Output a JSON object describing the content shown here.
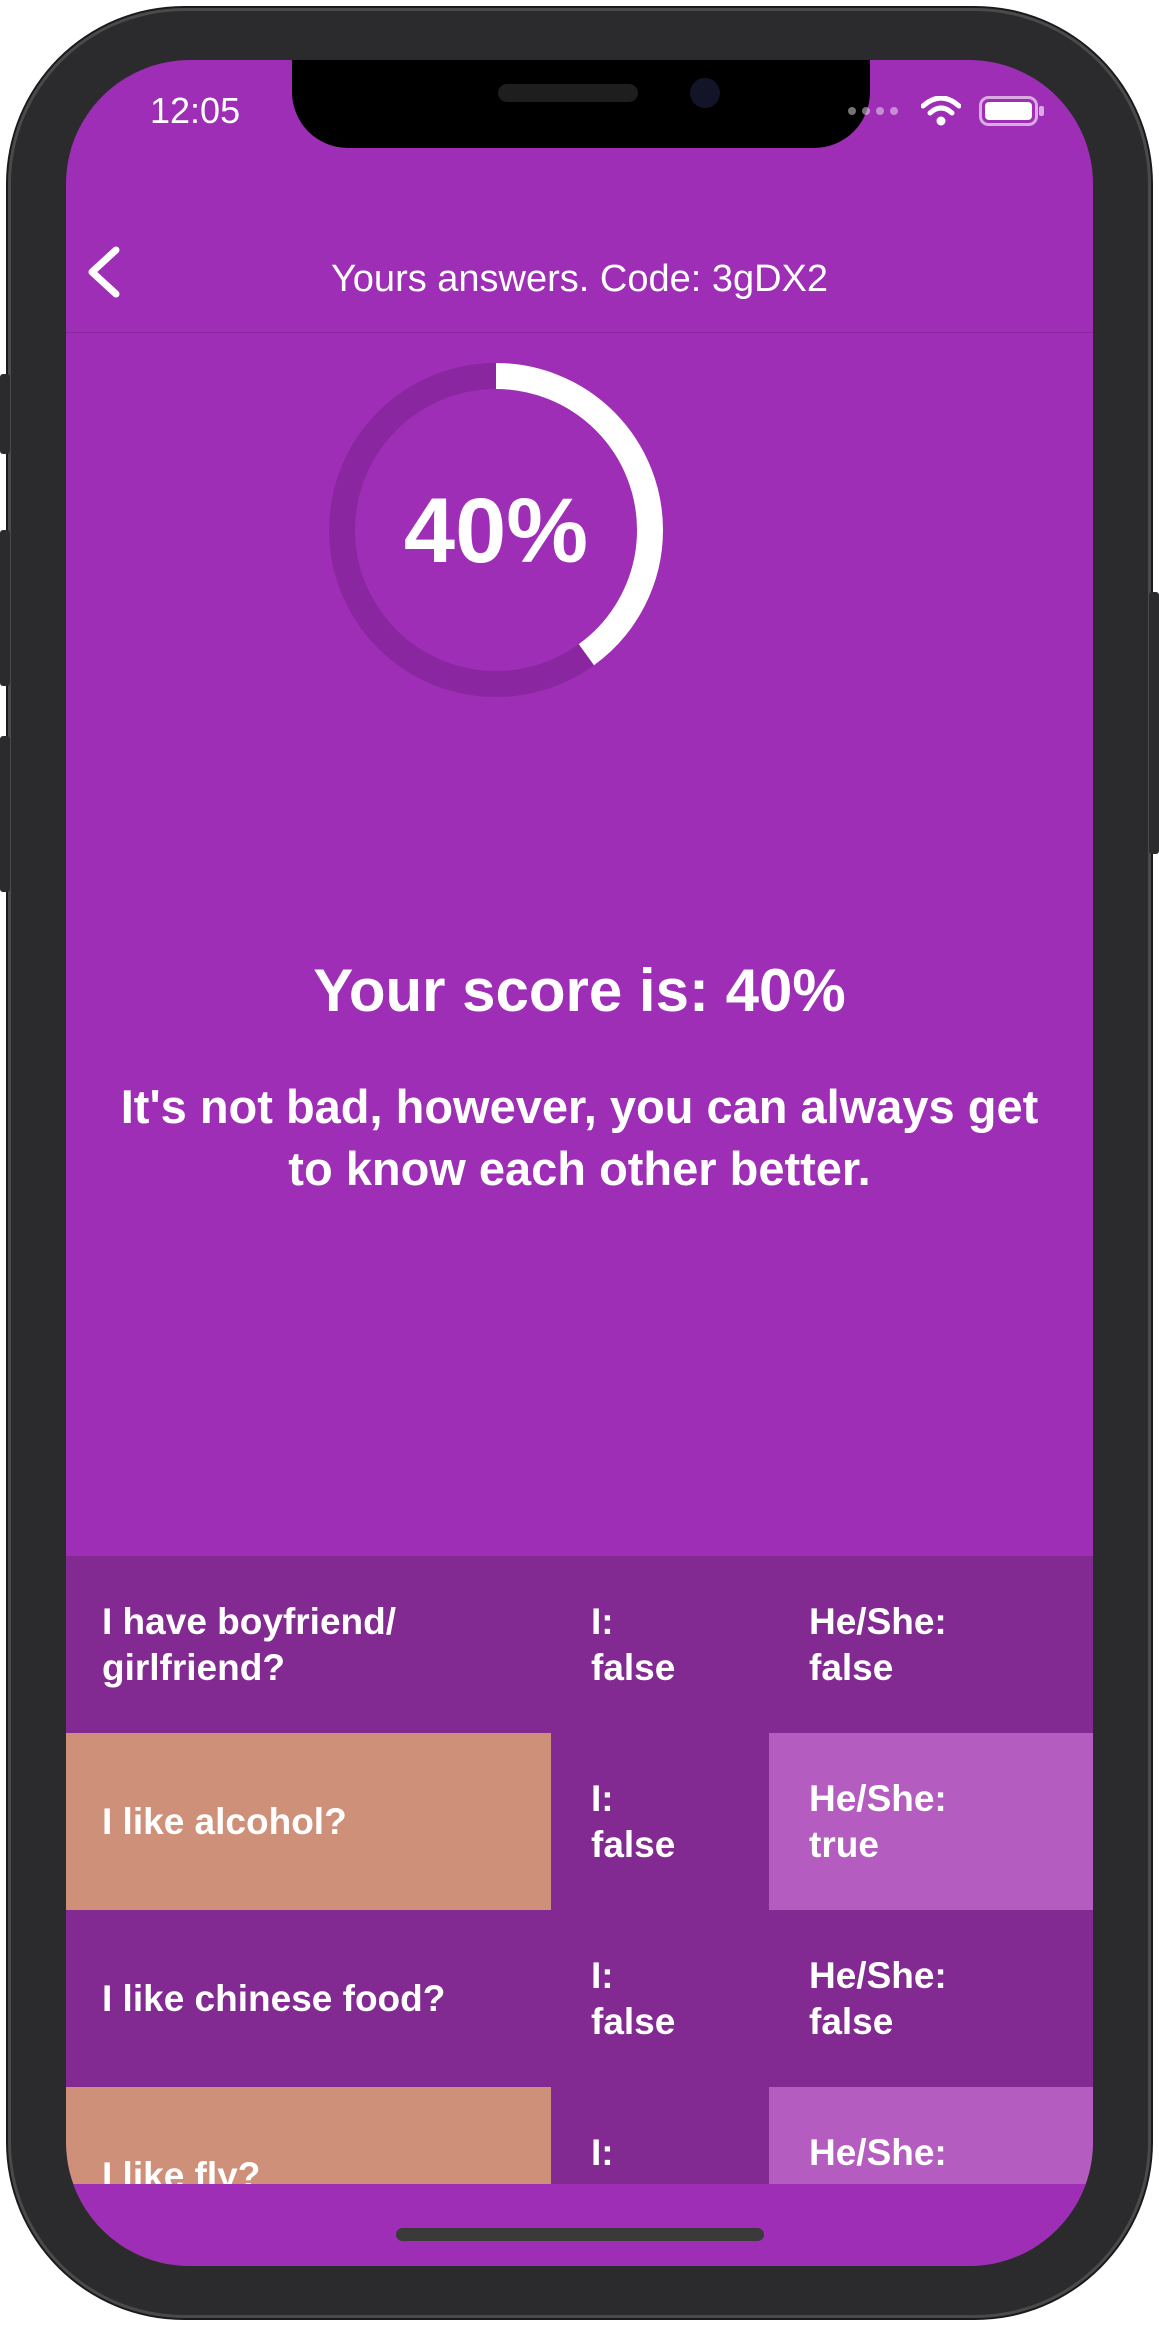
{
  "status_bar": {
    "time": "12:05",
    "icons": [
      "signal-dots-icon",
      "wifi-icon",
      "battery-icon"
    ]
  },
  "nav": {
    "back_icon": "chevron-left-icon",
    "title": "Yours answers. Code: 3gDX2"
  },
  "score": {
    "progress_percent": 40,
    "ring_label": "40%",
    "headline": "Your score is: 40%",
    "message": "It's not bad, however, you can always get to know each other better."
  },
  "colors": {
    "background": "#9d2eb5",
    "row_dark": "#822a91",
    "mismatch_question": "#cf9079",
    "mismatch_answer": "#b45cc0",
    "ring_track": "#8a27a0",
    "ring_fill": "#ffffff"
  },
  "answers": [
    {
      "question": "I have boyfriend/ girlfriend?",
      "mine_label": "I:",
      "mine_value": "false",
      "theirs_label": "He/She:",
      "theirs_value": "false",
      "match": true
    },
    {
      "question": "I like alcohol?",
      "mine_label": "I:",
      "mine_value": "false",
      "theirs_label": "He/She:",
      "theirs_value": "true",
      "match": false
    },
    {
      "question": "I like chinese food?",
      "mine_label": "I:",
      "mine_value": "false",
      "theirs_label": "He/She:",
      "theirs_value": "false",
      "match": true
    },
    {
      "question": "I like fly?",
      "mine_label": "I:",
      "mine_value": "false",
      "theirs_label": "He/She:",
      "theirs_value": "true",
      "match": false
    }
  ]
}
